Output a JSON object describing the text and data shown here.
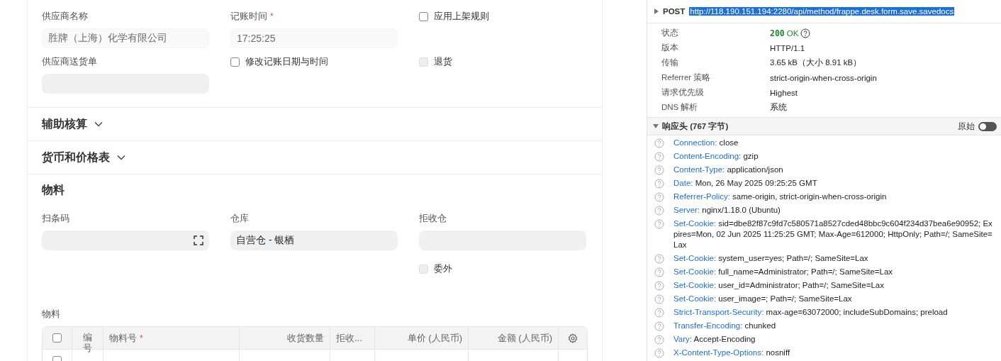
{
  "form": {
    "fields_top": [
      {
        "kind": "input",
        "label": "供应商名称",
        "value": "胜牌（上海）化学有限公司",
        "readonly": true
      },
      {
        "kind": "input",
        "label": "记账时间",
        "required_mark": "*",
        "value": "17:25:25",
        "readonly": true
      },
      {
        "kind": "checkbox",
        "label": "应用上架规则",
        "checked": false,
        "disabled": false
      },
      {
        "kind": "input",
        "label": "供应商送货单"
      },
      {
        "kind": "checkbox",
        "label": "修改记账日期与时间",
        "checked": false,
        "disabled": false
      },
      {
        "kind": "checkbox",
        "label": "退货",
        "checked": false,
        "disabled": true
      }
    ],
    "collapsed_sections": [
      {
        "title": "辅助核算",
        "expanded": false
      },
      {
        "title": "货币和价格表",
        "expanded": false
      }
    ],
    "items_section": {
      "title": "物料",
      "fields": [
        {
          "kind": "scan",
          "label": "扫条码"
        },
        {
          "kind": "input",
          "label": "仓库",
          "value": "自营仓 - 银栖"
        },
        {
          "kind": "input",
          "label": "拒收仓"
        },
        {
          "kind": "empty"
        },
        {
          "kind": "empty"
        },
        {
          "kind": "checkbox",
          "label": "委外",
          "checked": false,
          "disabled": true
        }
      ],
      "table": {
        "label": "物料",
        "header_checked": false,
        "rows": [
          {
            "checked": false
          }
        ],
        "columns": [
          {
            "kind": "check"
          },
          {
            "kind": "text",
            "label": "编号"
          },
          {
            "kind": "text",
            "label": "物料号",
            "required_mark": "*"
          },
          {
            "kind": "text",
            "label": "收货数量"
          },
          {
            "kind": "text",
            "label": "拒收..."
          },
          {
            "kind": "text",
            "label": "单价 (人民币)"
          },
          {
            "kind": "text",
            "label": "金额 (人民币)"
          },
          {
            "kind": "gear"
          }
        ]
      }
    }
  },
  "devtools": {
    "method": "POST",
    "url": "http://118.190.151.194:2280/api/method/frappe.desk.form.save.savedocs",
    "summary": [
      {
        "kind": "status",
        "label": "状态",
        "code": "200",
        "text": "OK"
      },
      {
        "kind": "text",
        "label": "版本",
        "value": "HTTP/1.1"
      },
      {
        "kind": "text",
        "label": "传输",
        "value": "3.65 kB（大小 8.91 kB）"
      },
      {
        "kind": "text",
        "label": "Referrer 策略",
        "value": "strict-origin-when-cross-origin"
      },
      {
        "kind": "text",
        "label": "请求优先级",
        "value": "Highest"
      },
      {
        "kind": "text",
        "label": "DNS 解析",
        "value": "系统"
      }
    ],
    "response_headers": {
      "title": "响应头 (767 字节)",
      "expanded": true,
      "raw_label": "原始",
      "raw_on": false,
      "headers": [
        {
          "name": "Connection:",
          "value": "close"
        },
        {
          "name": "Content-Encoding:",
          "value": "gzip"
        },
        {
          "name": "Content-Type:",
          "value": "application/json"
        },
        {
          "name": "Date:",
          "value": "Mon, 26 May 2025 09:25:25 GMT"
        },
        {
          "name": "Referrer-Policy:",
          "value": "same-origin, strict-origin-when-cross-origin"
        },
        {
          "name": "Server:",
          "value": "nginx/1.18.0 (Ubuntu)"
        },
        {
          "name": "Set-Cookie:",
          "value": "sid=dbe82f87c9fd7c580571a8527cded48bbc9c604f234d37bea6e90952; Expires=Mon, 02 Jun 2025 11:25:25 GMT; Max-Age=612000; HttpOnly; Path=/; SameSite=Lax"
        },
        {
          "name": "Set-Cookie:",
          "value": "system_user=yes; Path=/; SameSite=Lax"
        },
        {
          "name": "Set-Cookie:",
          "value": "full_name=Administrator; Path=/; SameSite=Lax"
        },
        {
          "name": "Set-Cookie:",
          "value": "user_id=Administrator; Path=/; SameSite=Lax"
        },
        {
          "name": "Set-Cookie:",
          "value": "user_image=; Path=/; SameSite=Lax"
        },
        {
          "name": "Strict-Transport-Security:",
          "value": "max-age=63072000; includeSubDomains; preload"
        },
        {
          "name": "Transfer-Encoding:",
          "value": "chunked"
        },
        {
          "name": "Vary:",
          "value": "Accept-Encoding"
        },
        {
          "name": "X-Content-Type-Options:",
          "value": "nosniff"
        }
      ]
    }
  }
}
